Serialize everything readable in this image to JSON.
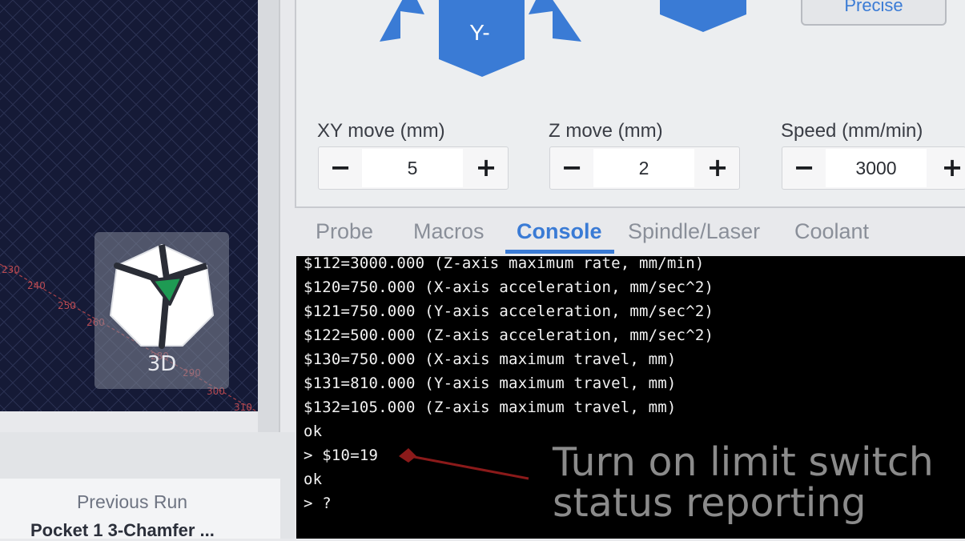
{
  "viewport": {
    "cube_label": "3D",
    "axis_ticks": [
      "230",
      "240",
      "250",
      "260",
      "280",
      "290",
      "300",
      "310"
    ]
  },
  "jog": {
    "y_minus_label": "Y-",
    "precise_label": "Precise",
    "xy_move": {
      "label": "XY move (mm)",
      "value": "5",
      "minus": "−",
      "plus": "+"
    },
    "z_move": {
      "label": "Z move (mm)",
      "value": "2",
      "minus": "−",
      "plus": "+"
    },
    "speed": {
      "label": "Speed (mm/min)",
      "value": "3000",
      "minus": "−",
      "plus": "+"
    }
  },
  "tabs": [
    {
      "label": "Probe",
      "active": false
    },
    {
      "label": "Macros",
      "active": false
    },
    {
      "label": "Console",
      "active": true
    },
    {
      "label": "Spindle/Laser",
      "active": false
    },
    {
      "label": "Coolant",
      "active": false
    }
  ],
  "console": {
    "lines": [
      "$112=3000.000 (Z-axis maximum rate, mm/min)",
      "$120=750.000 (X-axis acceleration, mm/sec^2)",
      "$121=750.000 (Y-axis acceleration, mm/sec^2)",
      "$122=500.000 (Z-axis acceleration, mm/sec^2)",
      "$130=750.000 (X-axis maximum travel, mm)",
      "$131=810.000 (Y-axis maximum travel, mm)",
      "$132=105.000 (Z-axis maximum travel, mm)",
      "ok",
      "> $10=19",
      "ok",
      "> ?"
    ]
  },
  "annotation": {
    "line1": "Turn on limit switch",
    "line2": "status reporting"
  },
  "previous_run": {
    "label": "Previous Run",
    "job_name": "Pocket 1 3-Chamfer ..."
  },
  "colors": {
    "accent": "#3a7bd5",
    "jog_blue": "#3a7bd5",
    "viewport_bg": "#151a36",
    "console_bg": "#000000"
  }
}
